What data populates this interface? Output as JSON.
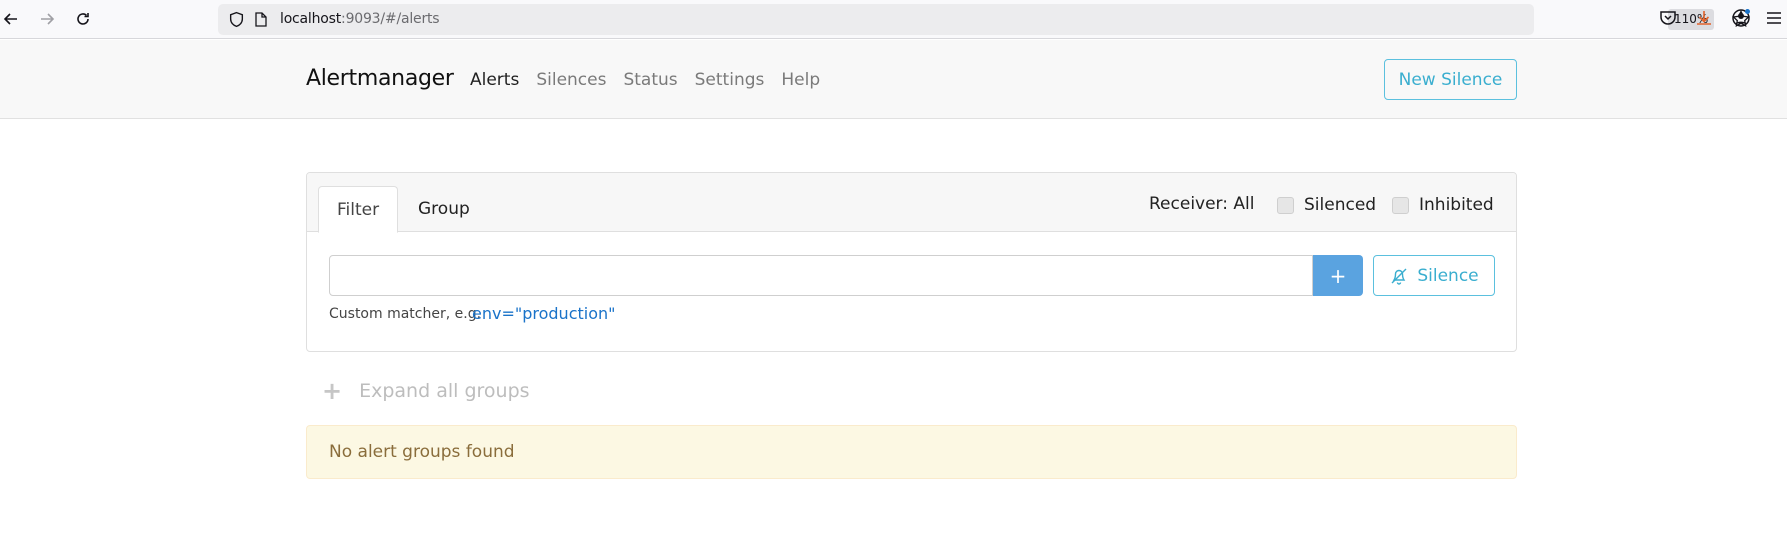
{
  "browser": {
    "url_host": "localhost",
    "url_rest": ":9093/#/alerts",
    "zoom": "110%"
  },
  "app": {
    "brand": "Alertmanager",
    "nav": [
      {
        "label": "Alerts",
        "active": true
      },
      {
        "label": "Silences"
      },
      {
        "label": "Status"
      },
      {
        "label": "Settings"
      },
      {
        "label": "Help"
      }
    ],
    "new_silence_label": "New Silence"
  },
  "filter_card": {
    "tabs": [
      "Filter",
      "Group"
    ],
    "receiver_label": "Receiver: All",
    "silenced_label": "Silenced",
    "inhibited_label": "Inhibited",
    "filter_value": "",
    "add_label": "+",
    "silence_label": "Silence",
    "hint_text": "Custom matcher, e.g.",
    "hint_example": "env=\"production\""
  },
  "expand_label": "Expand all groups",
  "empty_message": "No alert groups found",
  "colors": {
    "accent_outline": "#5bc0de",
    "primary_button": "#5aa3e0",
    "warning_bg": "#fcf8e3",
    "warning_text": "#8a6d3b"
  }
}
